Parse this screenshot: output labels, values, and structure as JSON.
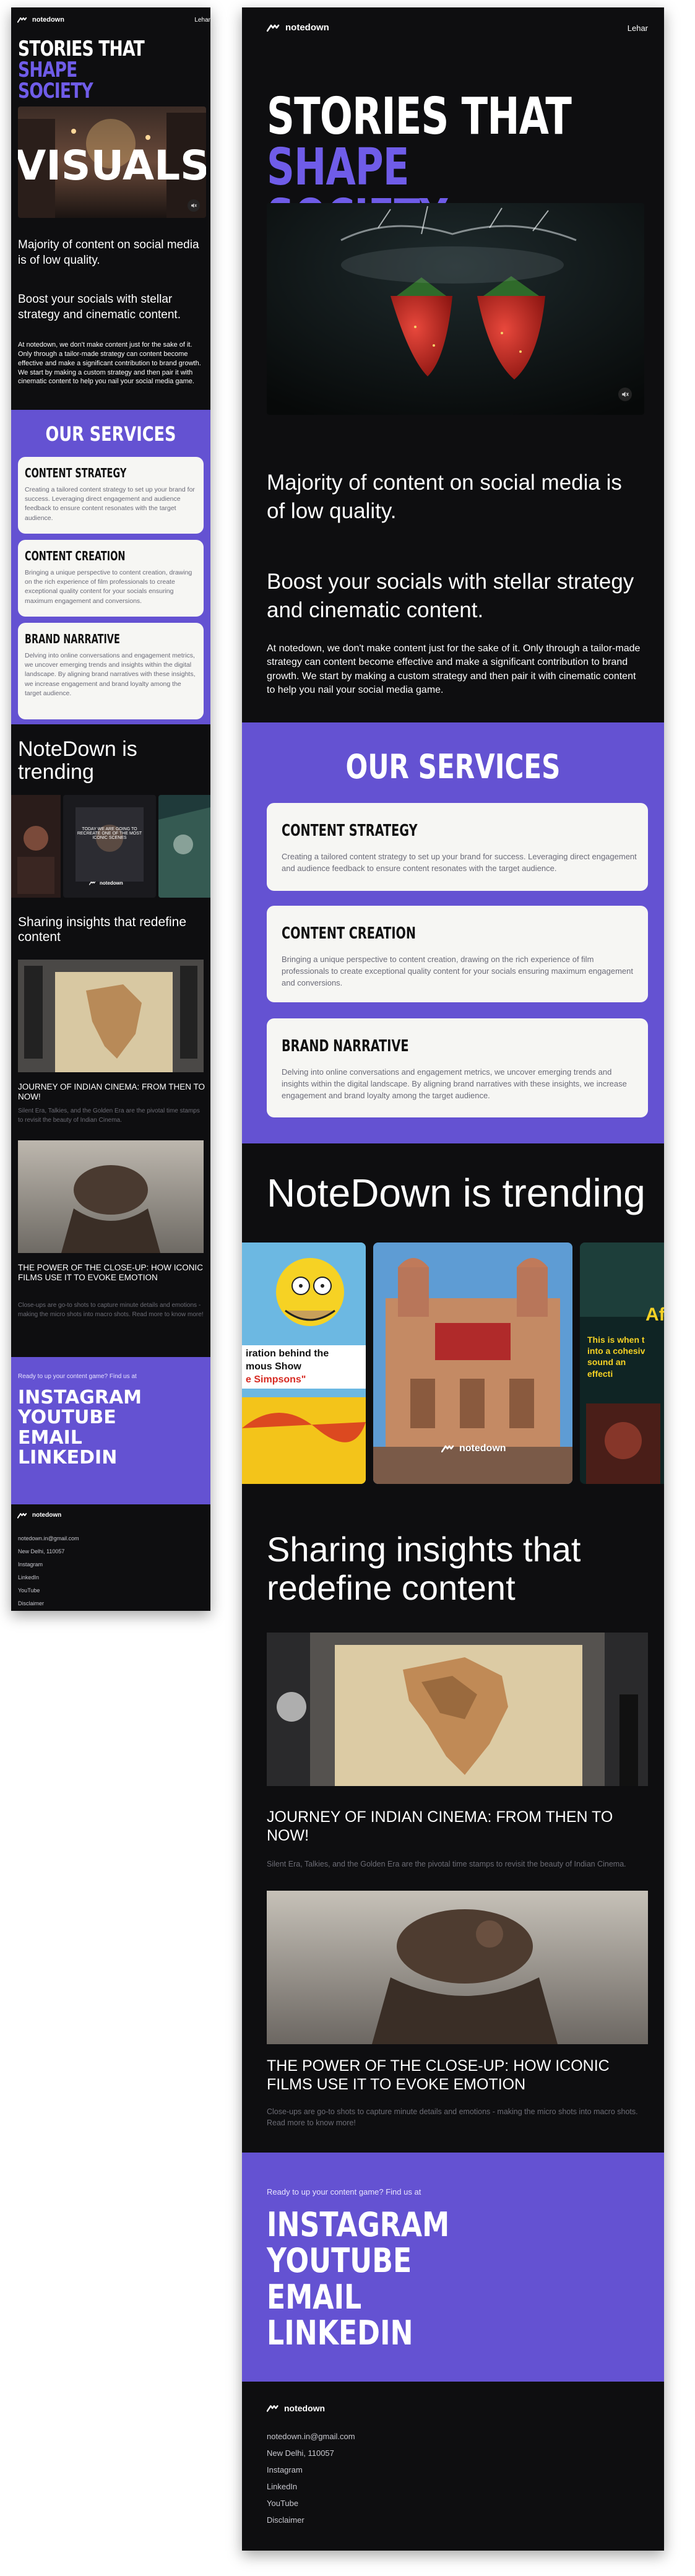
{
  "brand": {
    "name": "notedown",
    "nav_link": "Lehar"
  },
  "hero": {
    "title_line1": "STORIES THAT",
    "title_accent1": "SHAPE",
    "title_accent2": "SOCIETY",
    "visuals_word": "VISUALS"
  },
  "intro": {
    "headline1": "Majority of content on social media is of low quality.",
    "headline2": "Boost your socials with stellar strategy and cinematic content.",
    "body": "At notedown, we don't make content just for the sake of it. Only through a tailor-made strategy can content become effective and make a significant contribution to brand growth. We start by making a custom strategy and then pair it with cinematic content to help you nail your social media game."
  },
  "services": {
    "title": "OUR SERVICES",
    "items": [
      {
        "title": "CONTENT STRATEGY",
        "desc": "Creating a tailored content strategy to set up your brand for success. Leveraging direct engagement and audience feedback to ensure content resonates with the target audience."
      },
      {
        "title": "CONTENT CREATION",
        "desc": "Bringing a unique perspective to content creation, drawing on the rich experience of film professionals to create exceptional quality content for your socials ensuring maximum engagement and conversions."
      },
      {
        "title": "BRAND NARRATIVE",
        "desc": "Delving into online conversations and engagement metrics, we uncover emerging trends and insights within the digital landscape. By aligning brand narratives with these insights, we increase engagement and brand loyalty among the target audience."
      }
    ]
  },
  "trending": {
    "title": "NoteDown is trending",
    "reel1_caption_a": "iration behind the",
    "reel1_caption_b": "mous Show",
    "reel1_caption_c": "e Simpsons\"",
    "reel3_caption_a": "This is when t",
    "reel3_caption_b": "into a cohesiv",
    "reel3_caption_c": "sound an",
    "reel3_caption_d": "effecti",
    "small_reel_caption": "TODAY WE ARE GOING TO RECREATE ONE OF THE MOST ICONIC SCENES"
  },
  "insights": {
    "title": "Sharing insights that redefine content",
    "posts": [
      {
        "title": "JOURNEY OF INDIAN CINEMA: FROM THEN TO NOW!",
        "desc": "Silent Era, Talkies, and the Golden Era are the pivotal time stamps to revisit the beauty of Indian Cinema."
      },
      {
        "title": "THE POWER OF THE CLOSE-UP: HOW ICONIC FILMS USE IT TO EVOKE EMOTION",
        "desc": "Close-ups are go-to shots to capture minute details and emotions - making the micro shots into macro shots. Read more to know more!"
      }
    ]
  },
  "cta": {
    "prompt": "Ready to up your content game? Find us at",
    "links": [
      "INSTAGRAM",
      "YOUTUBE",
      "EMAIL",
      "LINKEDIN"
    ]
  },
  "footer": {
    "items": [
      "notedown.in@gmail.com",
      "New Delhi, 110057",
      "Instagram",
      "LinkedIn",
      "YouTube",
      "Disclaimer"
    ]
  },
  "colors": {
    "accent": "#6452d2",
    "accent_text": "#6f5ce8",
    "background": "#0e0e10",
    "card": "#f6f6f3"
  }
}
